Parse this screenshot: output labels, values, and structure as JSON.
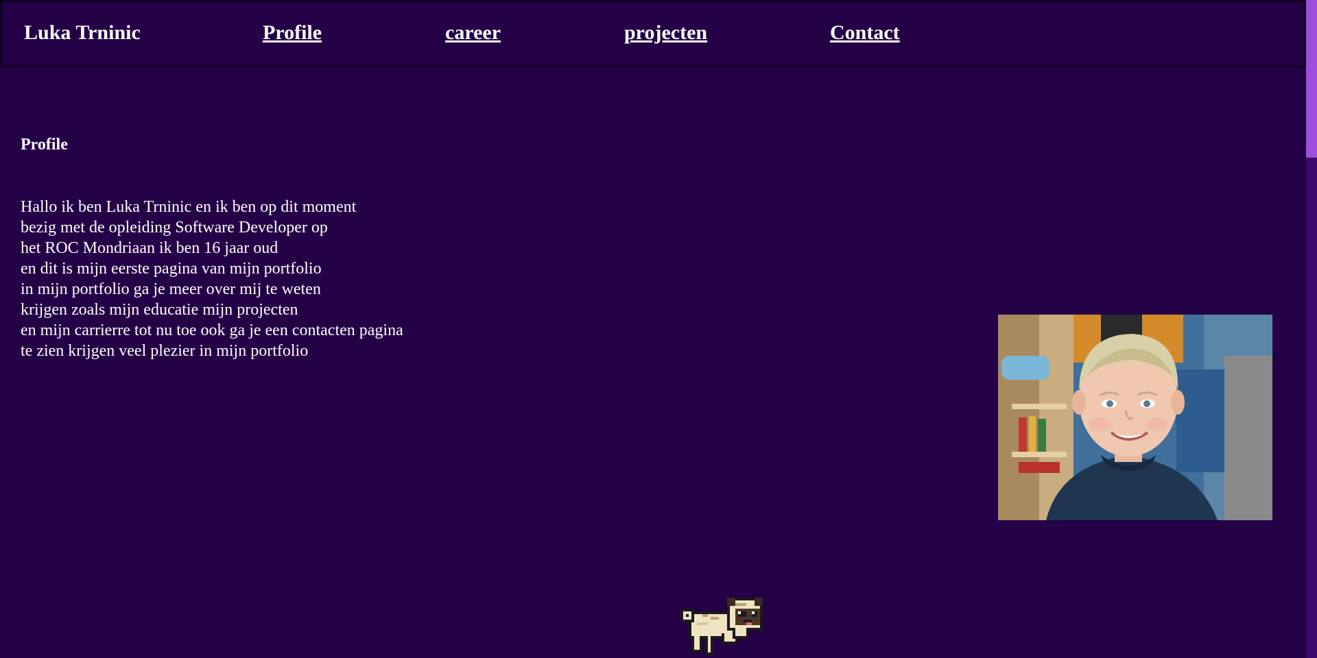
{
  "header": {
    "brand": "Luka Trninic",
    "nav": {
      "profile": "Profile",
      "career": "career",
      "projecten": "projecten",
      "contact": "Contact"
    }
  },
  "main": {
    "section_title": "Profile",
    "intro_lines": [
      "Hallo ik ben Luka Trninic en ik ben op dit moment",
      "bezig met de opleiding Software Developer op",
      "het ROC Mondriaan ik ben 16 jaar oud",
      "en dit is mijn eerste pagina van mijn portfolio",
      "in mijn portfolio ga je meer over mij te weten",
      "krijgen zoals mijn educatie mijn projecten",
      "en mijn carrierre tot nu toe ook ga je een contacten pagina",
      "te zien krijgen veel plezier in mijn portfolio"
    ]
  },
  "colors": {
    "background": "#240046",
    "scrollbar_track": "#3c096c",
    "scrollbar_thumb": "#9d4edd"
  },
  "icons": {
    "pug": "pixel-pug-icon"
  }
}
